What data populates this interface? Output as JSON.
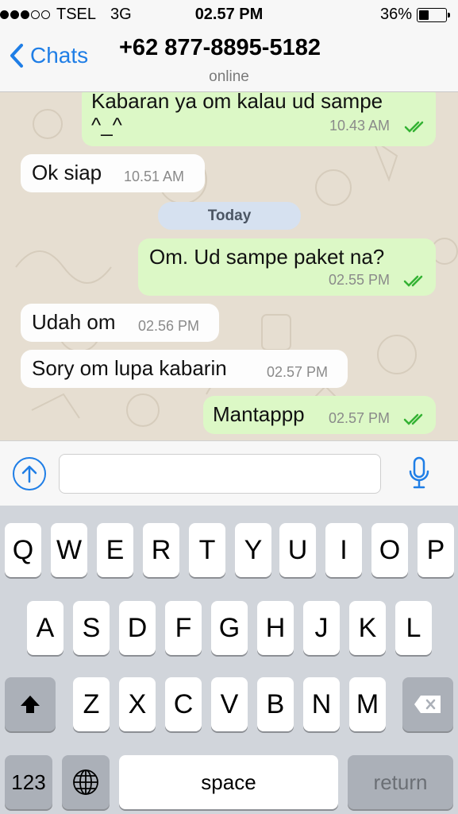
{
  "status_bar": {
    "carrier": "TSEL",
    "network": "3G",
    "time": "02.57 PM",
    "battery": "36%",
    "battery_level": 0.36
  },
  "nav": {
    "back_label": "Chats",
    "contact": "+62 877-8895-5182",
    "status": "online"
  },
  "chat": {
    "messages": [
      {
        "direction": "out",
        "text_line1": "Kabaran ya om kalau ud sampe",
        "text_line2": "^_^",
        "time": "10.43 AM",
        "read": true
      },
      {
        "direction": "in",
        "text": "Ok siap",
        "time": "10.51 AM"
      },
      {
        "direction": "out",
        "text": "Om. Ud sampe paket na?",
        "time": "02.55 PM",
        "read": true
      },
      {
        "direction": "in",
        "text": "Udah om",
        "time": "02.56 PM"
      },
      {
        "direction": "in",
        "text": "Sory om lupa kabarin",
        "time": "02.57 PM"
      },
      {
        "direction": "out",
        "text": "Mantappp",
        "time": "02.57 PM",
        "read": true
      }
    ],
    "day_separator": "Today"
  },
  "input": {
    "value": "",
    "placeholder": ""
  },
  "keyboard": {
    "row1": [
      "Q",
      "W",
      "E",
      "R",
      "T",
      "Y",
      "U",
      "I",
      "O",
      "P"
    ],
    "row2": [
      "A",
      "S",
      "D",
      "F",
      "G",
      "H",
      "J",
      "K",
      "L"
    ],
    "row3": [
      "Z",
      "X",
      "C",
      "V",
      "B",
      "N",
      "M"
    ],
    "num_label": "123",
    "space_label": "space",
    "return_label": "return"
  },
  "colors": {
    "accent": "#1f7ee6",
    "outgoing_bubble": "#dcf8c6",
    "incoming_bubble": "#fdfdfd",
    "read_ticks": "#34b233"
  }
}
